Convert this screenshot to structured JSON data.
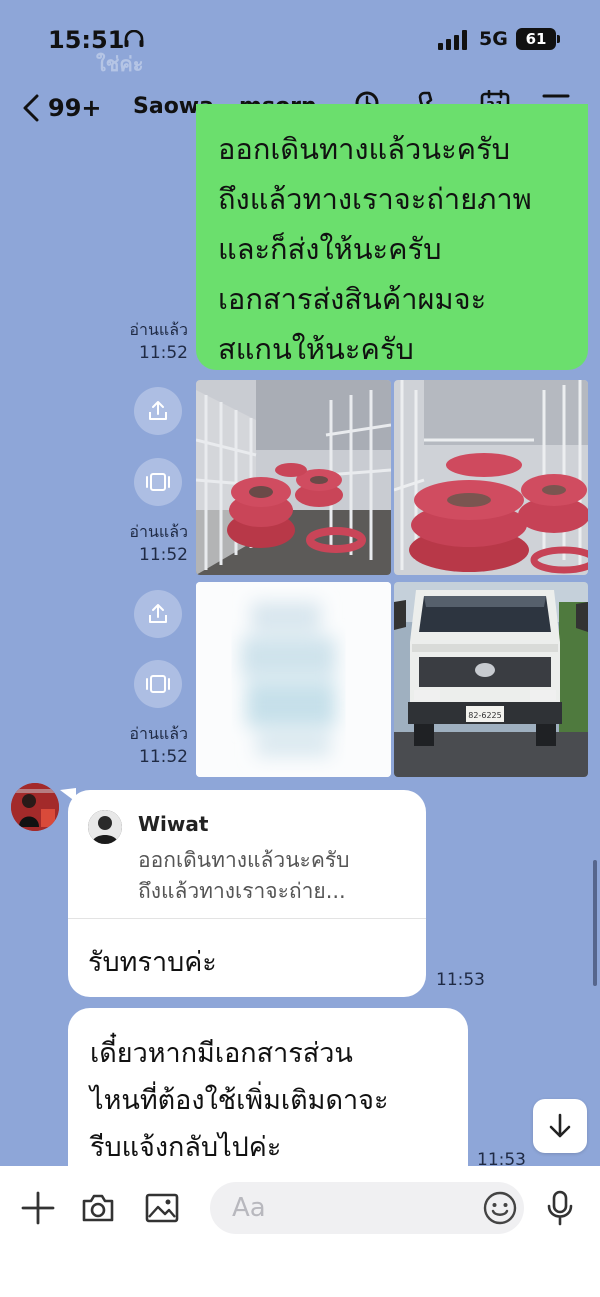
{
  "status_bar": {
    "time": "15:51",
    "network": "5G",
    "battery": "61"
  },
  "ghost_text": "ใช่ค่ะ",
  "header": {
    "back_count": "99+",
    "title": "Saowa...msorn",
    "icons": [
      "search-icon",
      "phone-icon",
      "calendar-icon",
      "menu-icon"
    ],
    "calendar_day": "31"
  },
  "messages": {
    "outgoing_text": {
      "lines": [
        "ออกเดินทางแล้วนะครับ",
        "ถึงแล้วทางเราจะถ่ายภาพ",
        "และก็ส่งให้นะครับ",
        "เอกสารส่งสินค้าผมจะ",
        "สแกนให้นะครับ"
      ],
      "read_label": "อ่านแล้ว",
      "time": "11:52"
    },
    "outgoing_photos_1": {
      "read_label": "อ่านแล้ว",
      "time": "11:52"
    },
    "outgoing_photos_2": {
      "read_label": "อ่านแล้ว",
      "time": "11:52"
    },
    "incoming_reply": {
      "quoted_name": "Wiwat",
      "quoted_lines": [
        "ออกเดินทางแล้วนะครับ",
        "ถึงแล้วทางเราจะถ่าย..."
      ],
      "text": "รับทราบค่ะ",
      "time": "11:53"
    },
    "incoming_text": {
      "lines": [
        "เดี๋ยวหากมีเอกสารส่วน",
        "ไหนที่ต้องใช้เพิ่มเติมดาจะ",
        "รีบแจ้งกลับไปค่ะ"
      ],
      "time": "11:53"
    }
  },
  "input_bar": {
    "placeholder": "Aa"
  },
  "colors": {
    "chat_background": "#8ea6d8",
    "outgoing_bubble": "#6bdf6d",
    "incoming_bubble": "#ffffff"
  }
}
